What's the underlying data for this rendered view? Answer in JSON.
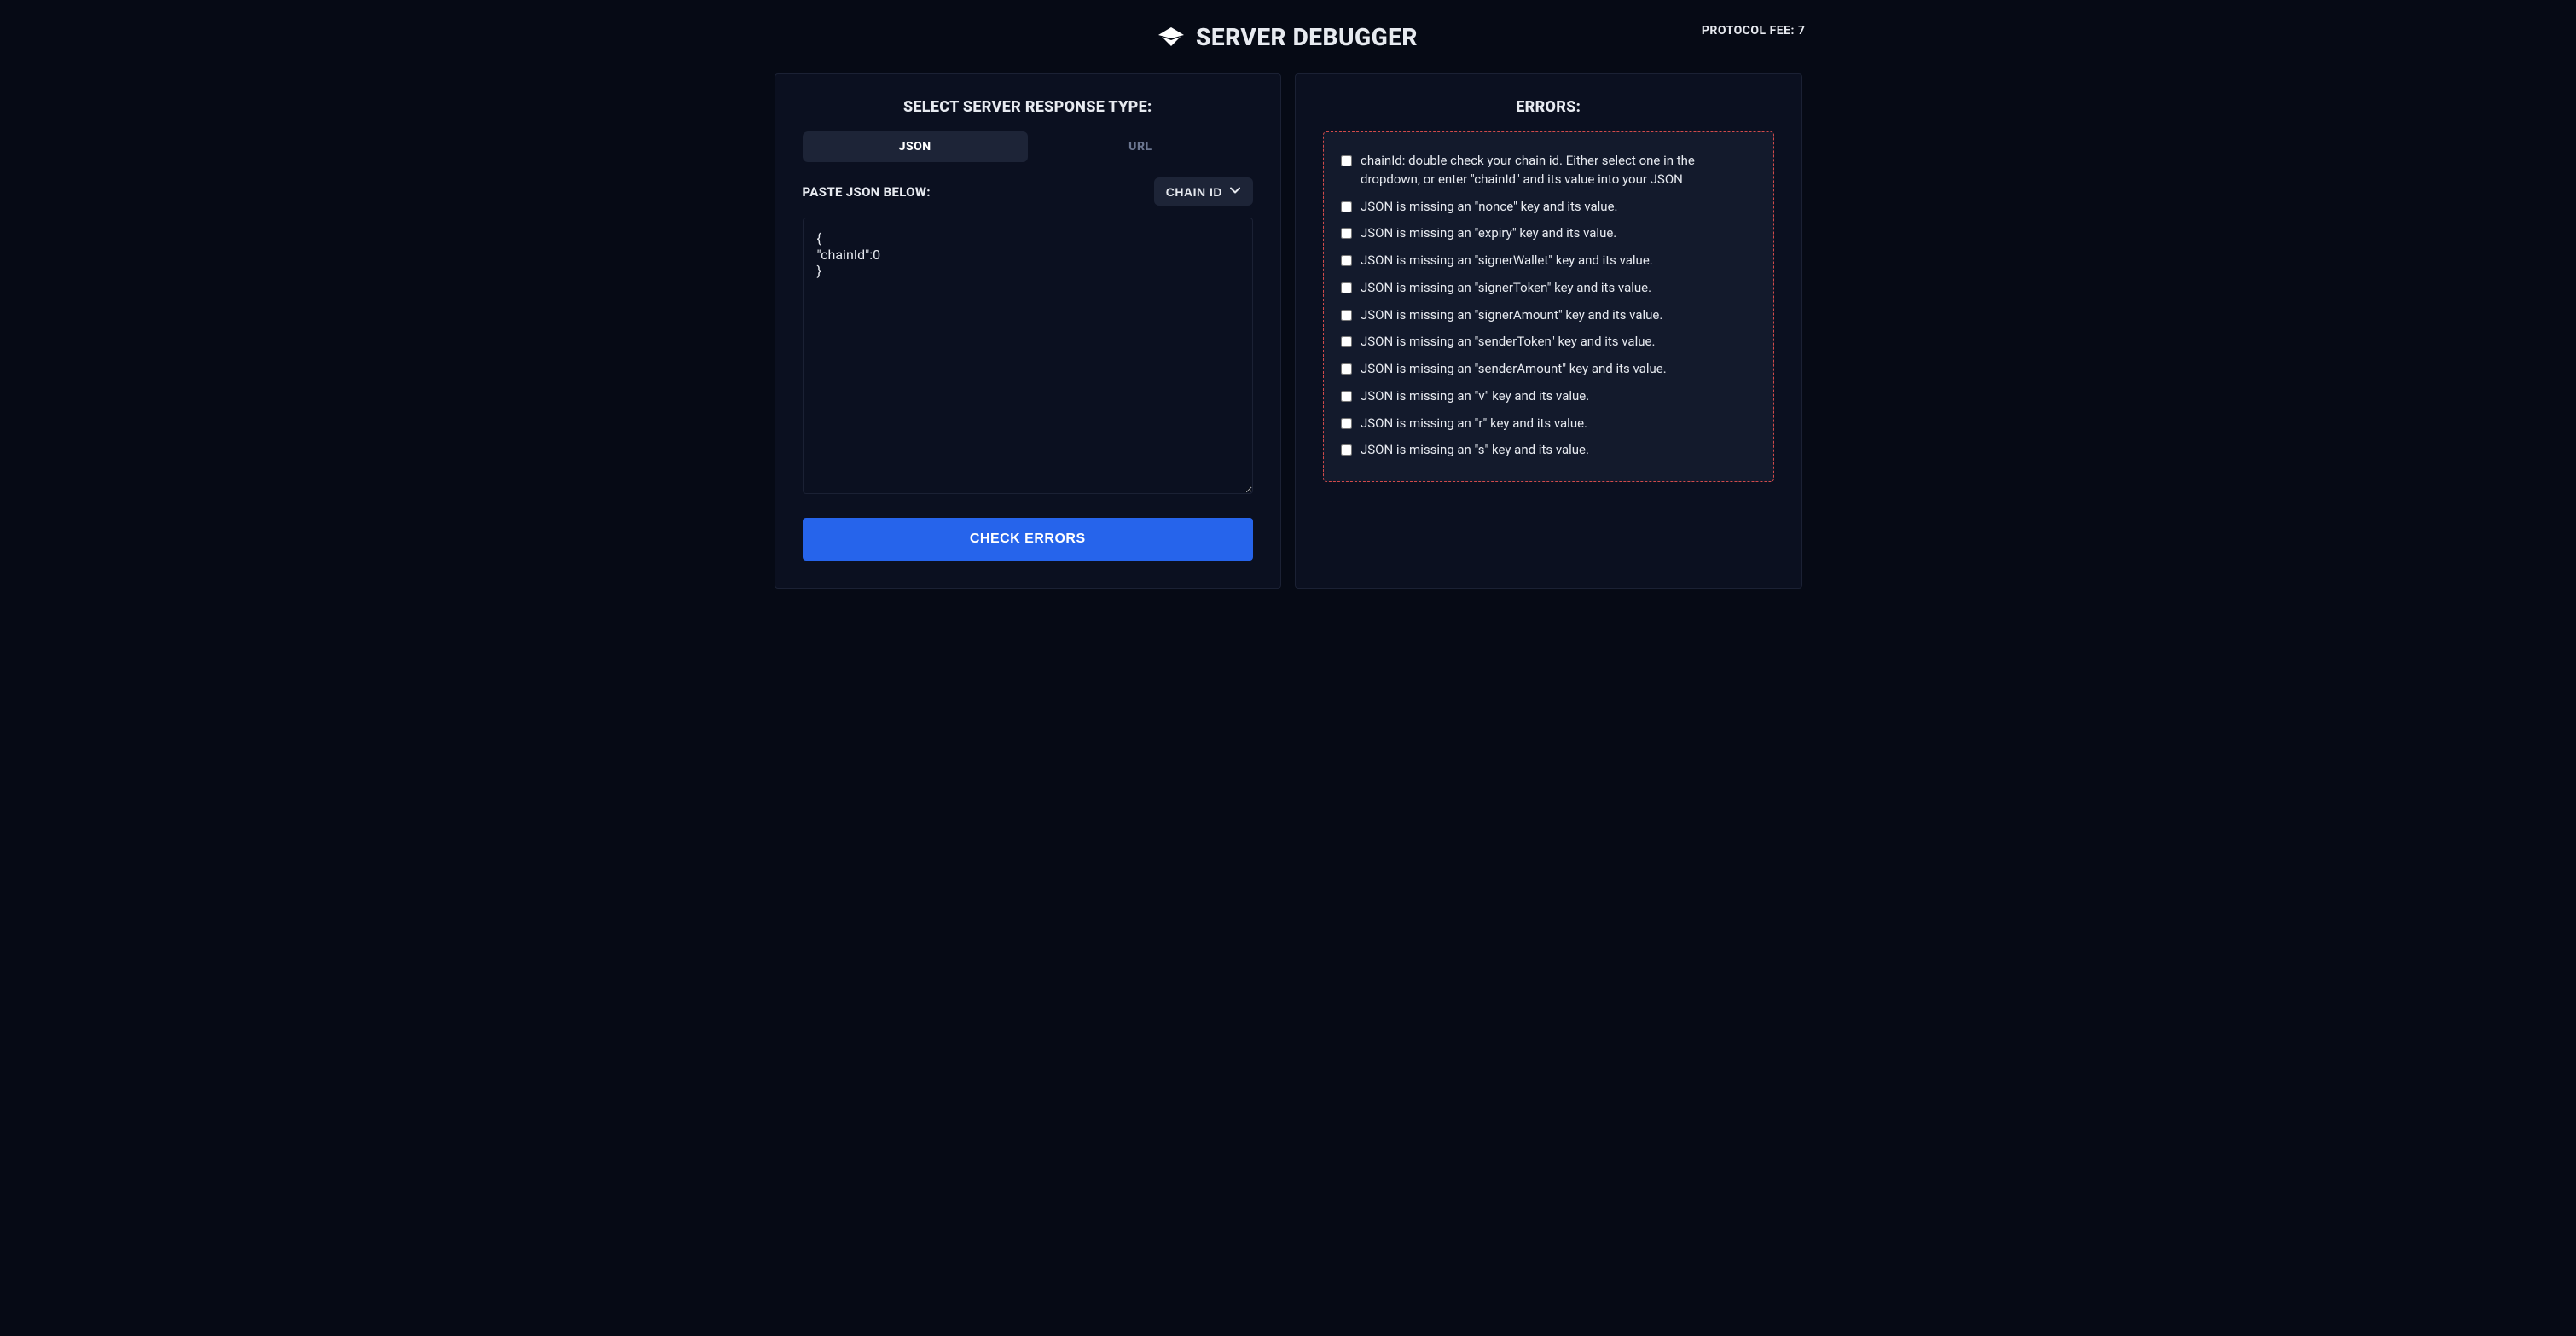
{
  "header": {
    "title": "SERVER DEBUGGER",
    "protocol_fee_label": "PROTOCOL FEE: 7"
  },
  "left": {
    "title": "SELECT SERVER RESPONSE TYPE:",
    "tabs": {
      "json": "JSON",
      "url": "URL"
    },
    "paste_label": "PASTE JSON BELOW:",
    "chain_button": "CHAIN ID",
    "textarea_value": "{\n\"chainId\":0\n}",
    "check_button": "CHECK ERRORS"
  },
  "right": {
    "title": "ERRORS:",
    "errors": [
      "chainId: double check your chain id. Either select one in the dropdown, or enter \"chainId\" and its value into your JSON",
      "JSON is missing an \"nonce\" key and its value.",
      "JSON is missing an \"expiry\" key and its value.",
      "JSON is missing an \"signerWallet\" key and its value.",
      "JSON is missing an \"signerToken\" key and its value.",
      "JSON is missing an \"signerAmount\" key and its value.",
      "JSON is missing an \"senderToken\" key and its value.",
      "JSON is missing an \"senderAmount\" key and its value.",
      "JSON is missing an \"v\" key and its value.",
      "JSON is missing an \"r\" key and its value.",
      "JSON is missing an \"s\" key and its value."
    ]
  }
}
